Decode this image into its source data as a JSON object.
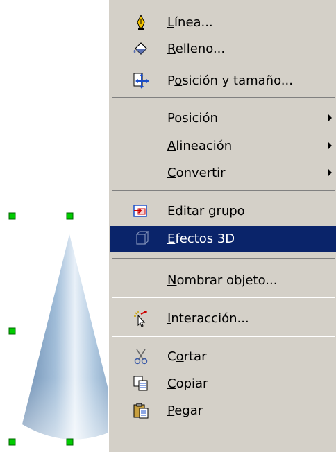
{
  "menu": {
    "items": [
      {
        "pre": "",
        "u": "L",
        "post": "ínea...",
        "icon": "pen-icon",
        "submenu": false
      },
      {
        "pre": "",
        "u": "R",
        "post": "elleno...",
        "icon": "paint-bucket-icon",
        "submenu": false
      },
      {
        "pre": "P",
        "u": "o",
        "post": "sición y tamaño...",
        "icon": "position-size-icon",
        "submenu": false
      },
      {
        "pre": "",
        "u": "P",
        "post": "osición",
        "icon": "",
        "submenu": true
      },
      {
        "pre": "",
        "u": "A",
        "post": "lineación",
        "icon": "",
        "submenu": true
      },
      {
        "pre": "",
        "u": "C",
        "post": "onvertir",
        "icon": "",
        "submenu": true
      },
      {
        "pre": "E",
        "u": "d",
        "post": "itar grupo",
        "icon": "edit-group-icon",
        "submenu": false
      },
      {
        "pre": "",
        "u": "E",
        "post": "fectos 3D",
        "icon": "cube-3d-icon",
        "submenu": false,
        "highlighted": true
      },
      {
        "pre": "",
        "u": "N",
        "post": "ombrar objeto...",
        "icon": "",
        "submenu": false
      },
      {
        "pre": "",
        "u": "I",
        "post": "nteracción...",
        "icon": "interaction-icon",
        "submenu": false
      },
      {
        "pre": "C",
        "u": "o",
        "post": "rtar",
        "icon": "scissors-icon",
        "submenu": false
      },
      {
        "pre": "",
        "u": "C",
        "post": "opiar",
        "icon": "copy-icon",
        "submenu": false
      },
      {
        "pre": "",
        "u": "P",
        "post": "egar",
        "icon": "paste-icon",
        "submenu": false
      }
    ]
  },
  "colors": {
    "menu_bg": "#d4d0c8",
    "highlight": "#0a246a",
    "handle": "#00cc00"
  }
}
